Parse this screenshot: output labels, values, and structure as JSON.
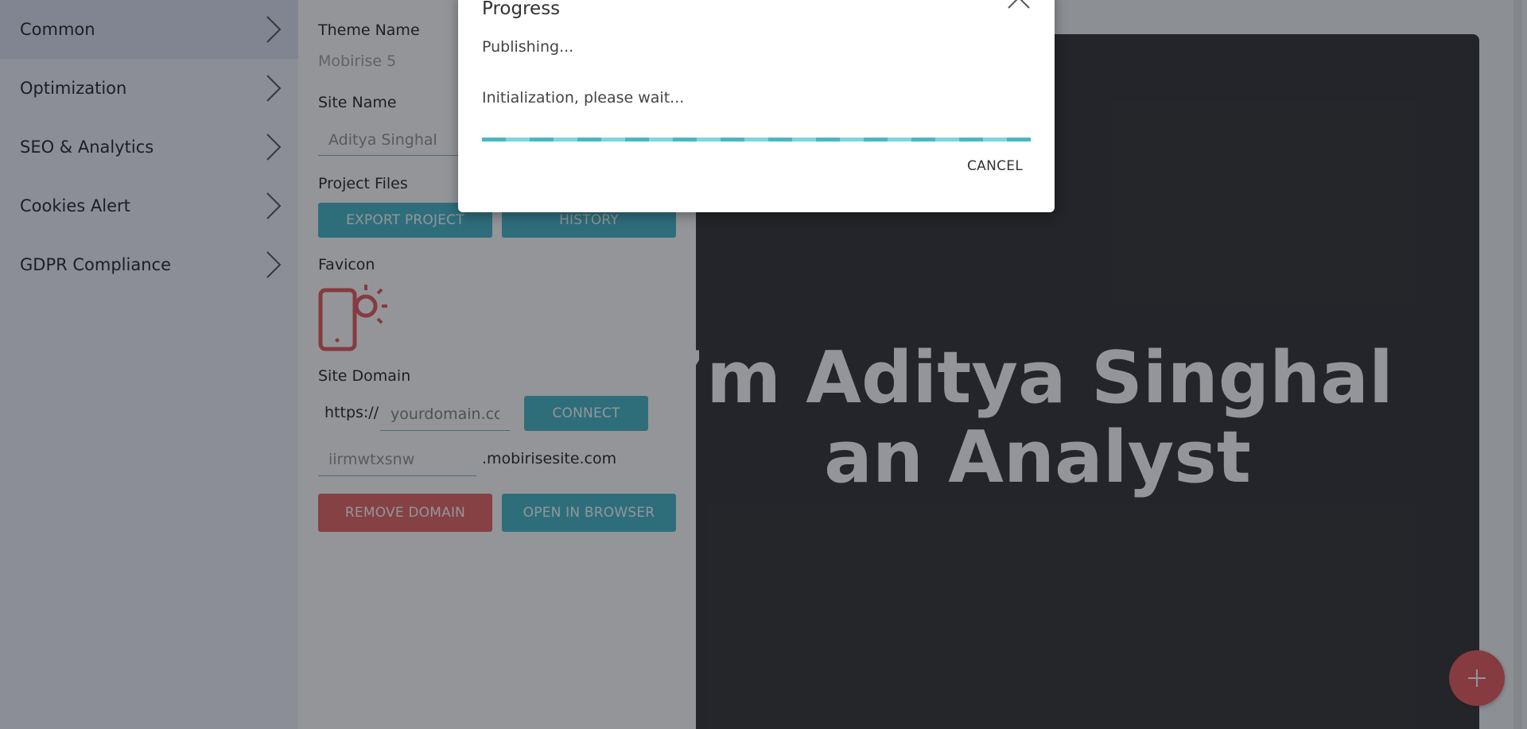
{
  "sidebar": {
    "items": [
      {
        "label": "Common"
      },
      {
        "label": "Optimization"
      },
      {
        "label": "SEO & Analytics"
      },
      {
        "label": "Cookies Alert"
      },
      {
        "label": "GDPR Compliance"
      }
    ]
  },
  "settings": {
    "theme_name_label": "Theme Name",
    "theme_name_value": "Mobirise 5",
    "site_name_label": "Site Name",
    "site_name_value": "Aditya Singhal",
    "project_files_label": "Project Files",
    "export_button": "EXPORT PROJECT",
    "history_button": "HISTORY",
    "favicon_label": "Favicon",
    "site_domain_label": "Site Domain",
    "domain_prefix": "https://",
    "domain_placeholder": "yourdomain.com",
    "connect_button": "CONNECT",
    "subdomain_value": "iirmwtxsnw",
    "subdomain_suffix": ".mobirisesite.com",
    "remove_domain_button": "REMOVE DOMAIN",
    "open_browser_button": "OPEN IN BROWSER"
  },
  "preview": {
    "hero_line1": ", I’m Aditya Singhal",
    "hero_line2": "an Analyst"
  },
  "dialog": {
    "title": "Progress",
    "status": "Publishing...",
    "message": "Initialization, please wait...",
    "cancel": "CANCEL"
  },
  "colors": {
    "accent_teal": "#34b0c2",
    "danger_red": "#e45757",
    "fab_red": "#e24b4b"
  },
  "icons": {
    "sidebar_chevron": "chevron-right-icon",
    "favicon": "phone-sun-icon",
    "close": "chevron-up-icon",
    "fab": "plus-icon"
  }
}
